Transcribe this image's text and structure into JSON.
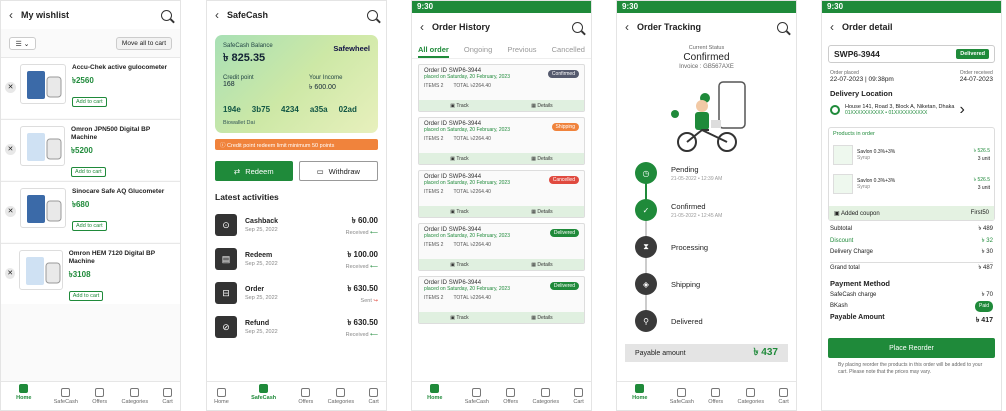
{
  "nav": [
    {
      "label": "Home"
    },
    {
      "label": "SafeCash"
    },
    {
      "label": "Offers"
    },
    {
      "label": "Categories"
    },
    {
      "label": "Cart"
    }
  ],
  "time": "9:30",
  "wishlist": {
    "title": "My wishlist",
    "move_all": "Move all to cart",
    "add": "Add to cart",
    "items": [
      {
        "name": "Accu-Chek active gulocometer",
        "price": "৳2560"
      },
      {
        "name": "Omron JPN500 Digital BP Machine",
        "price": "৳5200"
      },
      {
        "name": "Sinocare Safe AQ Glucometer",
        "price": "৳680"
      },
      {
        "name": "Omron HEM 7120 Digital BP Machine",
        "price": "৳3108"
      }
    ]
  },
  "safecash": {
    "title": "SafeCash",
    "balance_label": "SafeCash Balance",
    "balance": "৳ 825.35",
    "logo": "Safewheel",
    "credit_label": "Credit point",
    "credit": "168",
    "income_label": "Your Income",
    "income": "৳ 600.00",
    "codes": [
      "194e",
      "3b75",
      "4234",
      "a35a",
      "02ad"
    ],
    "bday": "Biowallet Dai",
    "alert": "Credit point redeem limit minimum 50 points",
    "redeem": "Redeem",
    "withdraw": "Withdraw",
    "latest": "Latest activities",
    "acts": [
      {
        "name": "Cashback",
        "date": "Sep 25, 2022",
        "amount": "৳ 60.00",
        "status": "Received"
      },
      {
        "name": "Redeem",
        "date": "Sep 25, 2022",
        "amount": "৳ 100.00",
        "status": "Received"
      },
      {
        "name": "Order",
        "date": "Sep 25, 2022",
        "amount": "৳ 630.50",
        "status": "Sent"
      },
      {
        "name": "Refund",
        "date": "Sep 25, 2022",
        "amount": "৳ 630.50",
        "status": "Received"
      }
    ]
  },
  "history": {
    "title": "Order History",
    "tabs": [
      "All order",
      "Ongoing",
      "Previous",
      "Cancelled"
    ],
    "id_label": "Order ID",
    "id": "SWP6-3944",
    "placed": "placed on Saturday, 20 February, 2023",
    "items": "ITEMS",
    "items_v": "2",
    "total": "TOTAL",
    "total_v": "৳2264.40",
    "track": "Track",
    "details": "Details",
    "statuses": [
      {
        "s": "Confirmed",
        "c": "#555a6e"
      },
      {
        "s": "Shipping",
        "c": "#f0833c"
      },
      {
        "s": "Cancelled",
        "c": "#e04a3f"
      },
      {
        "s": "Delivered",
        "c": "#1f8a3a"
      },
      {
        "s": "Delivered",
        "c": "#1f8a3a"
      }
    ]
  },
  "tracking": {
    "title": "Order Tracking",
    "current": "Current Status",
    "status": "Confirmed",
    "invoice": "Invoice : GB567AXE",
    "steps": [
      {
        "label": "Pending",
        "date": "21-05-2022 • 12:39 AM"
      },
      {
        "label": "Confirmed",
        "date": "21-05-2022 • 12:45 AM"
      },
      {
        "label": "Processing",
        "date": ""
      },
      {
        "label": "Shipping",
        "date": ""
      },
      {
        "label": "Delivered",
        "date": ""
      }
    ],
    "pay_label": "Payable amount",
    "pay": "৳ 437"
  },
  "detail": {
    "title": "Order detail",
    "id": "SWP6-3944",
    "badge": "Delivered",
    "placed_l": "Order placed",
    "placed": "22-07-2023 | 09:38pm",
    "recv_l": "Order received",
    "recv": "24-07-2023",
    "dl": "Delivery Location",
    "addr": "House 141, Road 3, Block A, Niketan, Dhaka",
    "phone": "01XXXXXXXXXX • 01XXXXXXXXXX",
    "pil": "Products in order",
    "products": [
      {
        "name": "Savlon 0.3%+3%",
        "type": "Syrup",
        "price": "৳ 526.5",
        "unit": "3 unit"
      },
      {
        "name": "Savlon 0.3%+3%",
        "type": "Syrup",
        "price": "৳ 526.5",
        "unit": "3 unit"
      }
    ],
    "coupon": "Added coupon",
    "coupon_v": "First50",
    "rows": [
      {
        "l": "Subtotal",
        "v": "৳ 489"
      },
      {
        "l": "Discount",
        "v": "৳ 32"
      },
      {
        "l": "Delivery Charge",
        "v": "৳ 30"
      },
      {
        "l": "Grand total",
        "v": "৳ 487"
      }
    ],
    "pm": "Payment Method",
    "sc": "SafeCash charge",
    "sc_v": "৳ 70",
    "bk": "BKash",
    "paid": "Paid",
    "pa": "Payable Amount",
    "pa_v": "৳ 417",
    "reorder": "Place Reorder",
    "note": "By placing reorder the products in this order will be added to your cart. Please note that the prices may vary."
  }
}
